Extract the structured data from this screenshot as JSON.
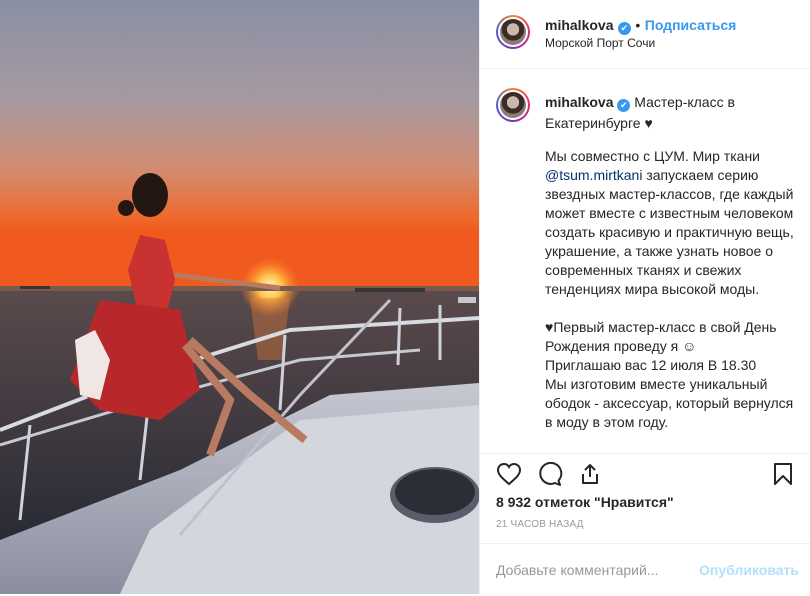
{
  "header": {
    "username": "mihalkova",
    "verified_mark": "✔",
    "separator": "•",
    "follow_label": "Подписаться",
    "location": "Морской Порт Сочи"
  },
  "caption": {
    "username": "mihalkova",
    "title": "Мастер-класс в Екатеринбурге ♥",
    "body_before_mention": "Мы совместно с ЦУМ. Мир ткани ",
    "mention": "@tsum.mirtkani",
    "body_after_mention": " запускаем серию звездных мастер-классов, где каждый может вместе с известным человеком создать красивую и практичную вещь, украшение, а также узнать новое о современных тканях и свежих тенденциях мира высокой моды.\n\n♥Первый мастер-класс в свой День Рождения проведу я ☺\nПриглашаю вас 12 июля В 18.30\nМы изготовим вместе уникальный ободок - аксессуар, который вернулся в моду в этом году."
  },
  "actions": {
    "icons": [
      "heart-icon",
      "comment-icon",
      "share-icon",
      "bookmark-icon"
    ]
  },
  "likes_text": "8 932 отметок \"Нравится\"",
  "timestamp": "21 ЧАСОВ НАЗАД",
  "comment": {
    "placeholder": "Добавьте комментарий...",
    "post_label": "Опубликовать"
  },
  "colors": {
    "accent": "#3897f0",
    "link": "#003569",
    "muted": "#999999"
  }
}
